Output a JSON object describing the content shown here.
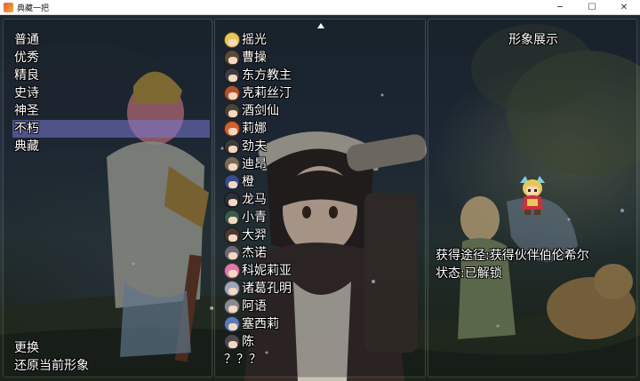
{
  "window": {
    "title": "典藏一把",
    "minimize_glyph": "─",
    "maximize_glyph": "☐",
    "close_glyph": "✕"
  },
  "rank_menu": {
    "items": [
      "普通",
      "优秀",
      "精良",
      "史诗",
      "神圣",
      "不朽",
      "典藏"
    ],
    "selected": "不朽"
  },
  "commands": {
    "change_label": "更换",
    "restore_label": "还原当前形象"
  },
  "characters": {
    "scroll_up_icon": "triangle-up-icon",
    "items": [
      {
        "name": "摇光",
        "icon_color": "#e8c75a"
      },
      {
        "name": "曹操",
        "icon_color": "#5a4a3a"
      },
      {
        "name": "东方教主",
        "icon_color": "#3c3c44"
      },
      {
        "name": "克莉丝汀",
        "icon_color": "#b0522e"
      },
      {
        "name": "酒剑仙",
        "icon_color": "#4a4438"
      },
      {
        "name": "莉娜",
        "icon_color": "#d4602c"
      },
      {
        "name": "劲夫",
        "icon_color": "#3a3a3a"
      },
      {
        "name": "迪昂",
        "icon_color": "#7a6a5a"
      },
      {
        "name": "橙",
        "icon_color": "#3a4a8a"
      },
      {
        "name": "龙马",
        "icon_color": "#2e2e36"
      },
      {
        "name": "小青",
        "icon_color": "#3e5a4a"
      },
      {
        "name": "大羿",
        "icon_color": "#4a3a30"
      },
      {
        "name": "杰诺",
        "icon_color": "#6a6a72"
      },
      {
        "name": "科妮莉亚",
        "icon_color": "#e07aa8"
      },
      {
        "name": "诸葛孔明",
        "icon_color": "#9aa8b8"
      },
      {
        "name": "阿语",
        "icon_color": "#8a8a90"
      },
      {
        "name": "塞西莉",
        "icon_color": "#5a7ab8"
      },
      {
        "name": "陈",
        "icon_color": "#4a4a50"
      },
      {
        "name": "？？？",
        "icon_color": ""
      }
    ]
  },
  "showcase": {
    "title": "形象展示",
    "obtain_line": "获得途径:获得伙伴伯伦希尔",
    "status_line": "状态:已解锁"
  },
  "colors": {
    "selection": "#7878d2",
    "text": "#ffffff",
    "panel_border": "#ffffff"
  }
}
